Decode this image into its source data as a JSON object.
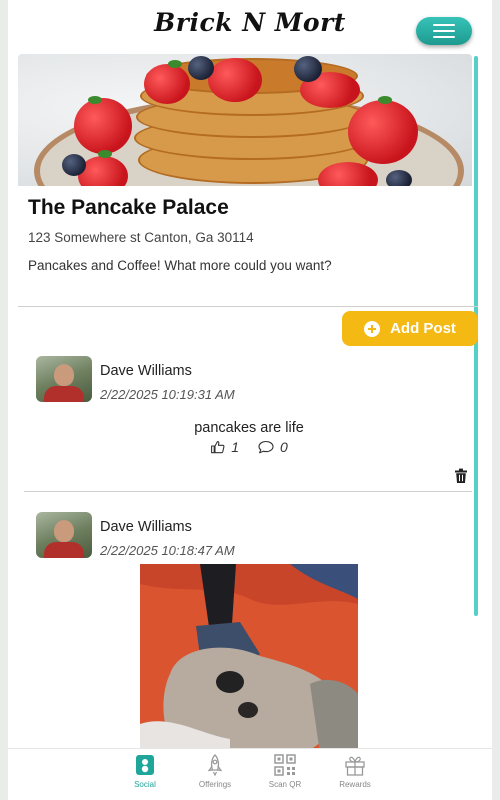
{
  "header": {
    "brand": "Brick N Mort",
    "menu_icon": "hamburger-menu-icon"
  },
  "business": {
    "name": "The Pancake Palace",
    "address": "123 Somewhere st Canton, Ga 30114",
    "description": "Pancakes and Coffee! What more could you want?"
  },
  "actions": {
    "add_post_label": "Add Post",
    "add_post_icon": "plus-circle-icon"
  },
  "posts": [
    {
      "author": "Dave Williams",
      "timestamp": "2/22/2025 10:19:31 AM",
      "text": "pancakes are life",
      "likes": "1",
      "comments": "0"
    },
    {
      "author": "Dave Williams",
      "timestamp": "2/22/2025 10:18:47 AM"
    }
  ],
  "bottom_nav": {
    "items": [
      {
        "label": "Social",
        "icon": "social-icon",
        "active": true
      },
      {
        "label": "Offerings",
        "icon": "rocket-icon",
        "active": false
      },
      {
        "label": "Scan QR",
        "icon": "qr-code-icon",
        "active": false
      },
      {
        "label": "Rewards",
        "icon": "gift-icon",
        "active": false
      }
    ]
  },
  "colors": {
    "accent": "#1fa59a",
    "button": "#f5b914"
  }
}
